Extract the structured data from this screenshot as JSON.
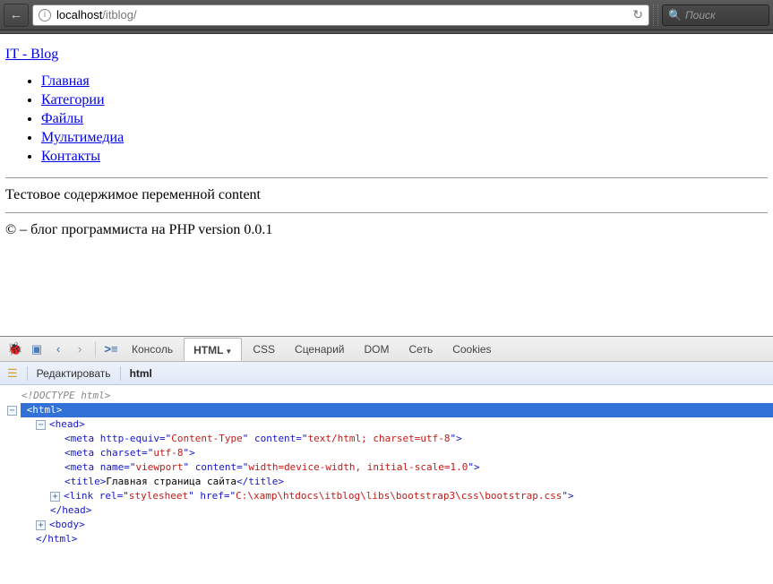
{
  "browser": {
    "url_domain": "localhost",
    "url_path": "/itblog/",
    "search_placeholder": "Поиск"
  },
  "page": {
    "title_link": "IT - Blog",
    "nav": [
      "Главная",
      "Категории",
      "Файлы",
      "Мультимедиа",
      "Контакты"
    ],
    "content_text": "Тестовое содержимое переменной content",
    "footer_text": "© – блог программиста на PHP version 0.0.1"
  },
  "devtools": {
    "tabs": [
      "Консоль",
      "HTML",
      "CSS",
      "Сценарий",
      "DOM",
      "Сеть",
      "Cookies"
    ],
    "active_tab": "HTML",
    "edit_label": "Редактировать",
    "breadcrumb": "html",
    "tree": {
      "doctype": "<!DOCTYPE html>",
      "html_open": "<html>",
      "head_open": "<head>",
      "meta1_prefix": "<meta http-equiv=\"",
      "meta1_v1": "Content-Type",
      "meta1_mid": "\" content=\"",
      "meta1_v2": "text/html; charset=utf-8",
      "meta1_suffix": "\">",
      "meta2_prefix": "<meta charset=\"",
      "meta2_v1": "utf-8",
      "meta2_suffix": "\">",
      "meta3_prefix": "<meta name=\"",
      "meta3_v1": "viewport",
      "meta3_mid": "\" content=\"",
      "meta3_v2": "width=device-width, initial-scale=1.0",
      "meta3_suffix": "\">",
      "title_open": "<title>",
      "title_text": "Главная страница сайта",
      "title_close": "</title>",
      "link_prefix": "<link rel=\"",
      "link_v1": "stylesheet",
      "link_mid": "\" href=\"",
      "link_v2": "C:\\xamp\\htdocs\\itblog\\libs\\bootstrap3\\css\\bootstrap.css",
      "link_suffix": "\">",
      "head_close": "</head>",
      "body_open": "<body>",
      "html_close": "</html>"
    }
  }
}
